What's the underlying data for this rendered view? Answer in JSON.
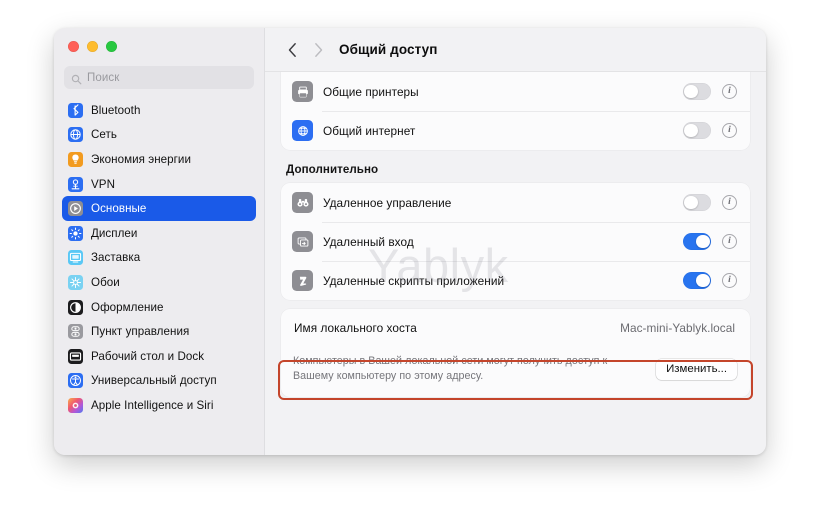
{
  "window": {
    "traffic_lights": [
      "close",
      "minimize",
      "zoom"
    ]
  },
  "sidebar": {
    "search": {
      "placeholder": "Поиск",
      "value": "",
      "icon": "search-icon"
    },
    "items": [
      {
        "label": "Bluetooth",
        "icon": "bluetooth-icon",
        "selected": false
      },
      {
        "label": "Сеть",
        "icon": "network-globe-icon",
        "selected": false
      },
      {
        "label": "Экономия энергии",
        "icon": "energy-bulb-icon",
        "selected": false
      },
      {
        "label": "VPN",
        "icon": "vpn-icon",
        "selected": false
      },
      {
        "label": "Основные",
        "icon": "general-gear-icon",
        "selected": true
      },
      {
        "label": "Дисплеи",
        "icon": "displays-icon",
        "selected": false
      },
      {
        "label": "Заставка",
        "icon": "screensaver-icon",
        "selected": false
      },
      {
        "label": "Обои",
        "icon": "wallpaper-icon",
        "selected": false
      },
      {
        "label": "Оформление",
        "icon": "appearance-icon",
        "selected": false
      },
      {
        "label": "Пункт управления",
        "icon": "control-center-icon",
        "selected": false
      },
      {
        "label": "Рабочий стол и Dock",
        "icon": "desktop-dock-icon",
        "selected": false
      },
      {
        "label": "Универсальный доступ",
        "icon": "accessibility-icon",
        "selected": false
      },
      {
        "label": "Apple Intelligence и Siri",
        "icon": "apple-intelligence-icon",
        "selected": false
      }
    ]
  },
  "toolbar": {
    "title": "Общий доступ",
    "back_icon": "chevron-left-icon",
    "forward_icon": "chevron-right-icon"
  },
  "main": {
    "top_rows": [
      {
        "label": "Общие принтеры",
        "icon": "printer-icon",
        "toggle": "off",
        "info": "i"
      },
      {
        "label": "Общий интернет",
        "icon": "internet-icon",
        "toggle": "off",
        "info": "i"
      }
    ],
    "advanced_section": {
      "heading": "Дополнительно",
      "rows": [
        {
          "label": "Удаленное управление",
          "icon": "binoculars-icon",
          "toggle": "off",
          "info": "i"
        },
        {
          "label": "Удаленный вход",
          "icon": "remote-login-icon",
          "toggle": "on",
          "info": "i"
        },
        {
          "label": "Удаленные скрипты приложений",
          "icon": "script-bolt-icon",
          "toggle": "on",
          "info": "i"
        }
      ]
    },
    "local_hostname": {
      "label": "Имя локального хоста",
      "value": "Mac-mini-Yablyk.local",
      "note": "Компьютеры в Вашей локальной сети могут получить доступ к Вашему компьютеру по этому адресу.",
      "button_label": "Изменить..."
    }
  },
  "watermark": {
    "text": "Yablyk"
  },
  "colors": {
    "selection_blue": "#1a5ae8",
    "toggle_on_blue": "#2874ef",
    "annotation_red": "#c4452b",
    "sidebar_bg": "#edecef",
    "content_bg": "#f2f2f4",
    "card_bg": "#fbfbfc"
  }
}
